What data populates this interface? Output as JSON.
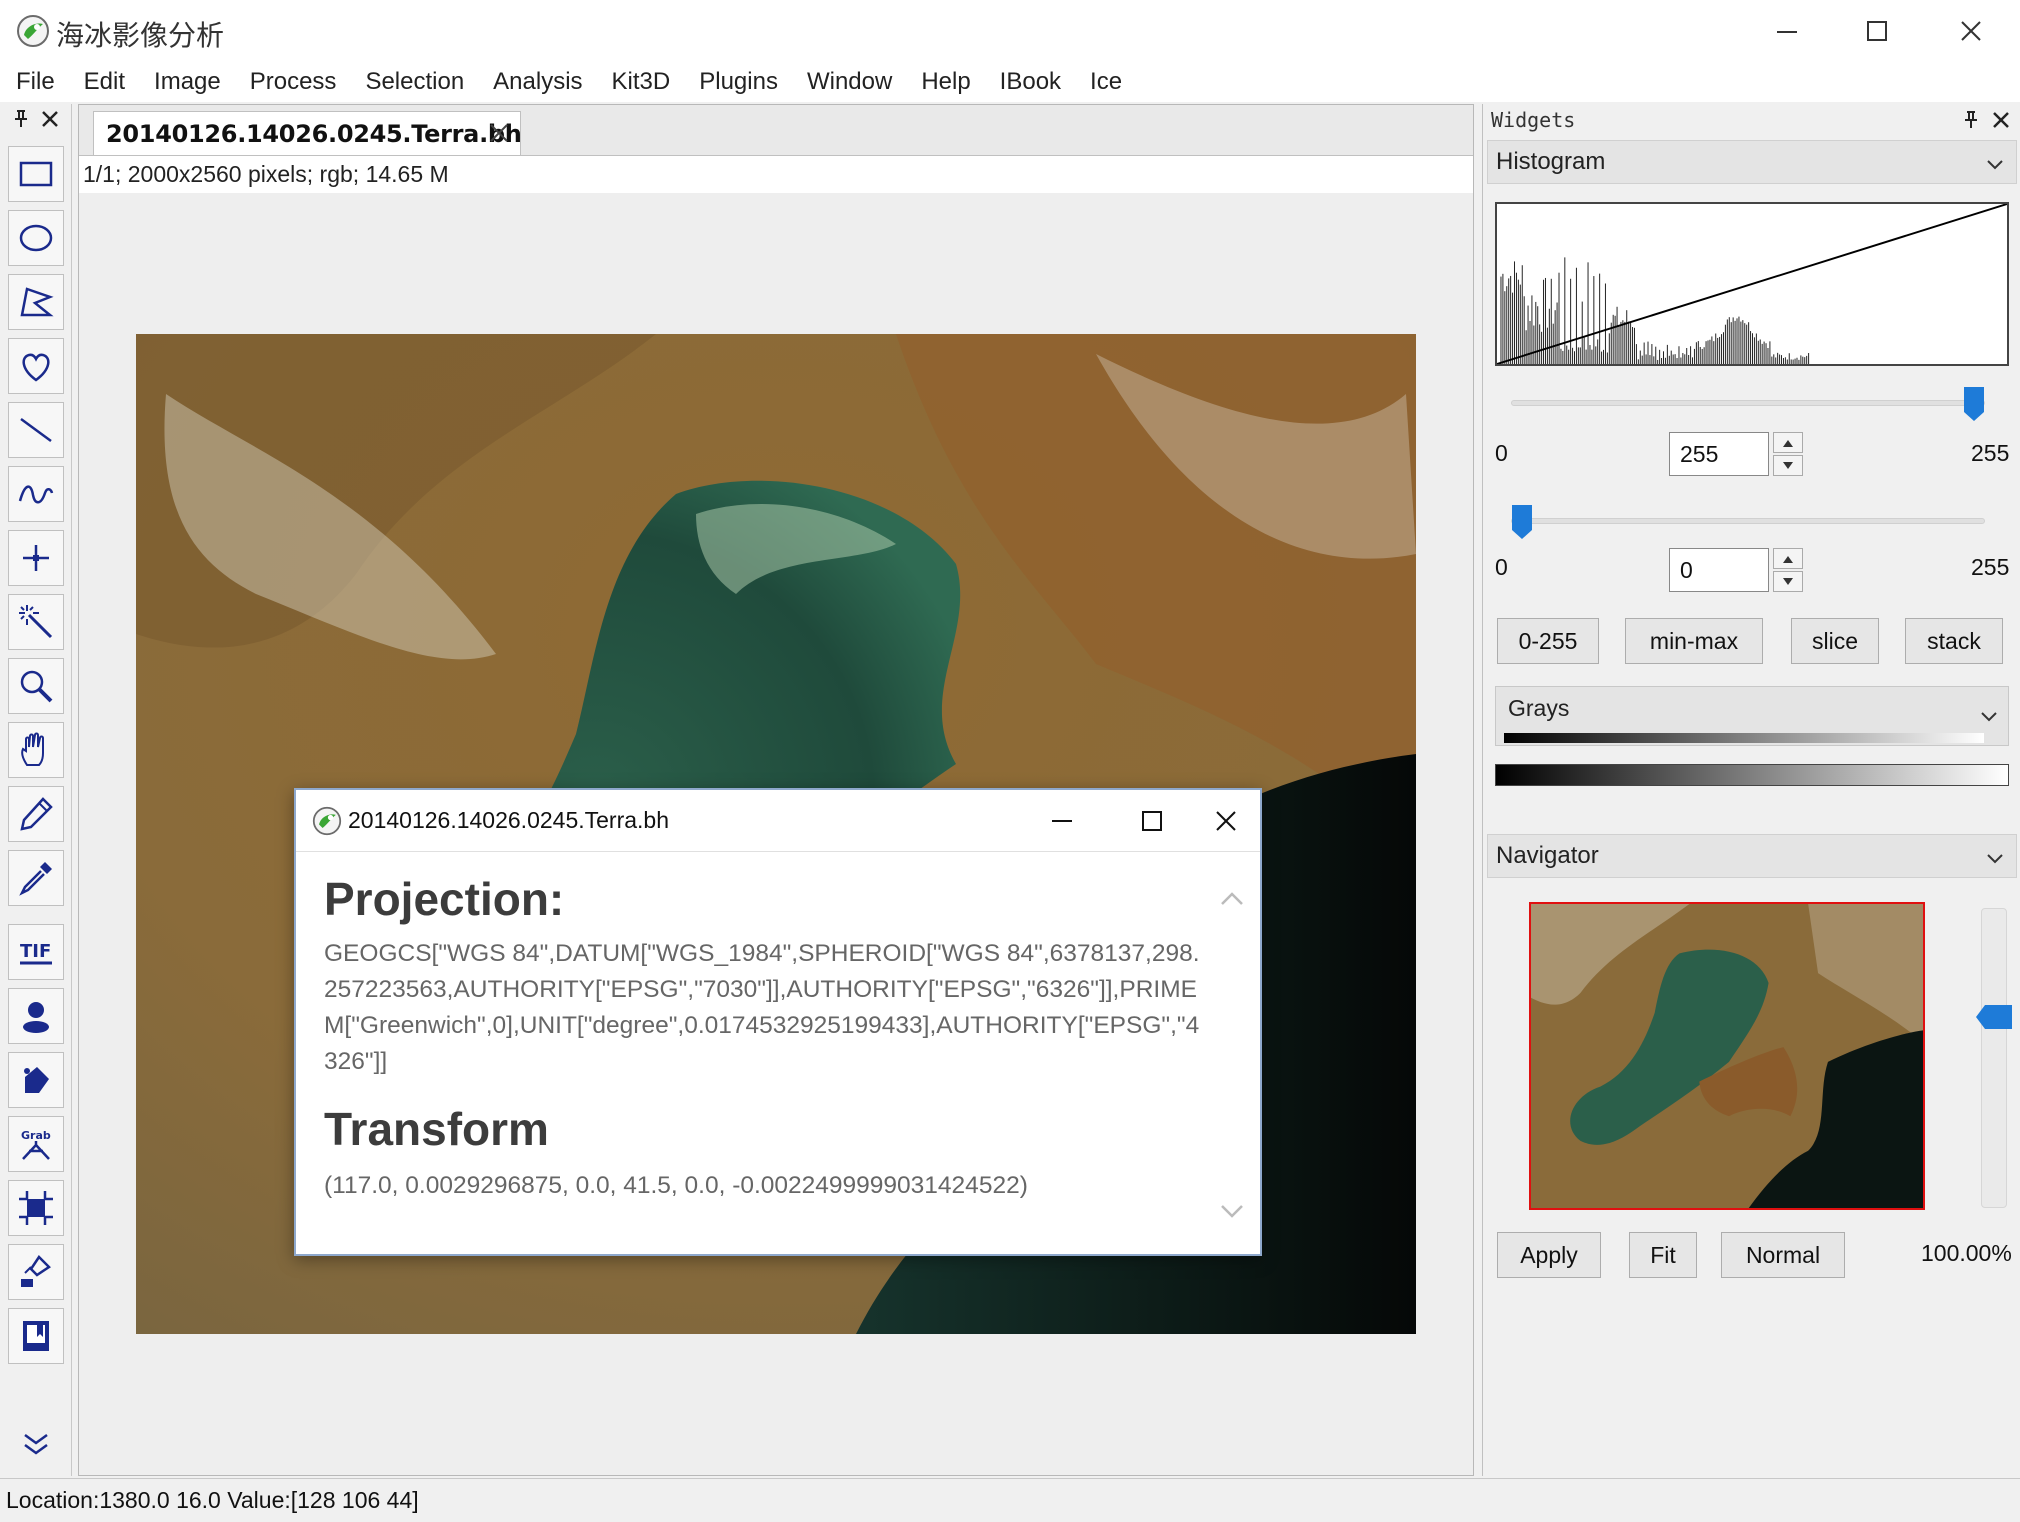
{
  "window": {
    "title": "海冰影像分析",
    "logo_icon": "app-logo-icon",
    "controls": [
      "minimize-icon",
      "maximize-icon",
      "close-icon"
    ]
  },
  "menubar": {
    "items": [
      "File",
      "Edit",
      "Image",
      "Process",
      "Selection",
      "Analysis",
      "Kit3D",
      "Plugins",
      "Window",
      "Help",
      "IBook",
      "Ice"
    ]
  },
  "toolbar": {
    "tools": [
      "rectangle-select-icon",
      "oval-select-icon",
      "polygon-select-icon",
      "freehand-select-icon",
      "line-icon",
      "freeline-icon",
      "point-icon",
      "wand-icon",
      "zoom-icon",
      "hand-icon",
      "pencil-icon",
      "color-picker-icon",
      "tif-icon",
      "user-icon",
      "bucket-icon",
      "grab-icon",
      "crop-icon",
      "paint-icon",
      "book-icon",
      "more-icon"
    ]
  },
  "document": {
    "tab_label": "20140126.14026.0245.Terra.bh",
    "info": "1/1;   2000x2560 pixels; rgb; 14.65 M"
  },
  "dialog": {
    "title": "20140126.14026.0245.Terra.bh",
    "projection_heading": "Projection:",
    "projection_text": "GEOGCS[\"WGS 84\",DATUM[\"WGS_1984\",SPHEROID[\"WGS 84\",6378137,298.257223563,AUTHORITY[\"EPSG\",\"7030\"]],AUTHORITY[\"EPSG\",\"6326\"]],PRIMEM[\"Greenwich\",0],UNIT[\"degree\",0.0174532925199433],AUTHORITY[\"EPSG\",\"4326\"]]",
    "transform_heading": "Transform",
    "transform_text": "(117.0, 0.0029296875, 0.0, 41.5, 0.0, -0.0022499999031424522)"
  },
  "widgets": {
    "title": "Widgets",
    "histogram": {
      "section_label": "Histogram",
      "max_slider": {
        "min_label": "0",
        "value": "255",
        "max_label": "255",
        "position": 1.0
      },
      "min_slider": {
        "min_label": "0",
        "value": "0",
        "max_label": "255",
        "position": 0.0
      },
      "buttons": [
        "0-255",
        "min-max",
        "slice",
        "stack"
      ],
      "lut": "Grays"
    },
    "navigator": {
      "section_label": "Navigator",
      "buttons": [
        "Apply",
        "Fit",
        "Normal"
      ],
      "zoom": "100.00%",
      "zoom_slider_position": 0.35
    }
  },
  "status": {
    "text": "Location:1380.0 16.0  Value:[128 106  44]"
  },
  "colors": {
    "accent": "#1e7bd8",
    "navigator_frame": "#e01010",
    "dialog_border": "#8ea8cc"
  }
}
